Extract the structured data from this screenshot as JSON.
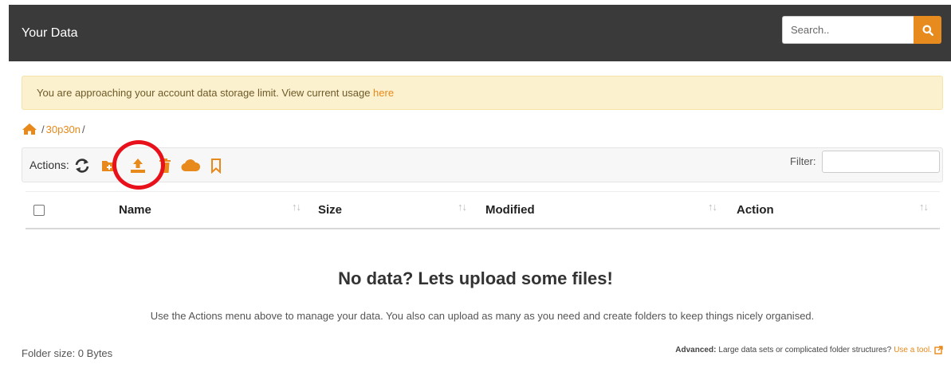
{
  "header": {
    "title": "Your Data",
    "search_placeholder": "Search.."
  },
  "alert": {
    "text": "You are approaching your account data storage limit. View current usage ",
    "link": "here"
  },
  "breadcrumb": {
    "sep1": "/",
    "folder": "30p30n",
    "sep2": "/"
  },
  "actions": {
    "label": "Actions:",
    "icons": [
      "refresh-icon",
      "new-folder-icon",
      "upload-icon",
      "delete-icon",
      "cloud-icon",
      "bookmark-icon"
    ],
    "filter_label": "Filter:",
    "filter_value": ""
  },
  "table": {
    "columns": [
      "Name",
      "Size",
      "Modified",
      "Action"
    ],
    "sort_glyph": "↑↓"
  },
  "empty": {
    "title": "No data? Lets upload some files!",
    "subtitle": "Use the Actions menu above to manage your data. You also can upload as many as you need and create folders to keep things nicely organised."
  },
  "footer": {
    "folder_size": "Folder size: 0 Bytes",
    "advanced_label": "Advanced:",
    "advanced_text": "Large data sets or complicated folder structures?",
    "advanced_link": "Use a tool."
  },
  "colors": {
    "accent": "#e8891b",
    "header_bg": "#3a3a3a",
    "highlight": "#e8101a"
  }
}
